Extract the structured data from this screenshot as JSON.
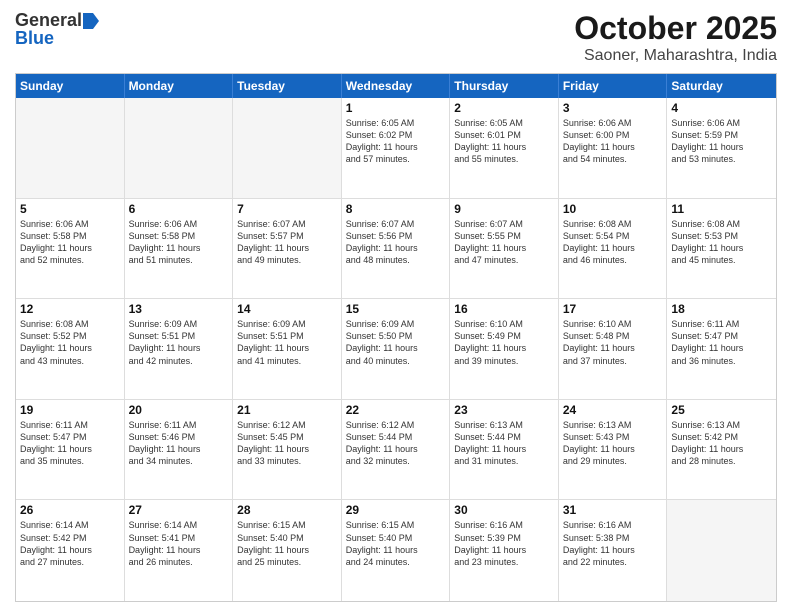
{
  "logo": {
    "general": "General",
    "blue": "Blue"
  },
  "title": "October 2025",
  "location": "Saoner, Maharashtra, India",
  "headers": [
    "Sunday",
    "Monday",
    "Tuesday",
    "Wednesday",
    "Thursday",
    "Friday",
    "Saturday"
  ],
  "rows": [
    [
      {
        "day": "",
        "info": "",
        "empty": true
      },
      {
        "day": "",
        "info": "",
        "empty": true
      },
      {
        "day": "",
        "info": "",
        "empty": true
      },
      {
        "day": "1",
        "info": "Sunrise: 6:05 AM\nSunset: 6:02 PM\nDaylight: 11 hours\nand 57 minutes."
      },
      {
        "day": "2",
        "info": "Sunrise: 6:05 AM\nSunset: 6:01 PM\nDaylight: 11 hours\nand 55 minutes."
      },
      {
        "day": "3",
        "info": "Sunrise: 6:06 AM\nSunset: 6:00 PM\nDaylight: 11 hours\nand 54 minutes."
      },
      {
        "day": "4",
        "info": "Sunrise: 6:06 AM\nSunset: 5:59 PM\nDaylight: 11 hours\nand 53 minutes."
      }
    ],
    [
      {
        "day": "5",
        "info": "Sunrise: 6:06 AM\nSunset: 5:58 PM\nDaylight: 11 hours\nand 52 minutes."
      },
      {
        "day": "6",
        "info": "Sunrise: 6:06 AM\nSunset: 5:58 PM\nDaylight: 11 hours\nand 51 minutes."
      },
      {
        "day": "7",
        "info": "Sunrise: 6:07 AM\nSunset: 5:57 PM\nDaylight: 11 hours\nand 49 minutes."
      },
      {
        "day": "8",
        "info": "Sunrise: 6:07 AM\nSunset: 5:56 PM\nDaylight: 11 hours\nand 48 minutes."
      },
      {
        "day": "9",
        "info": "Sunrise: 6:07 AM\nSunset: 5:55 PM\nDaylight: 11 hours\nand 47 minutes."
      },
      {
        "day": "10",
        "info": "Sunrise: 6:08 AM\nSunset: 5:54 PM\nDaylight: 11 hours\nand 46 minutes."
      },
      {
        "day": "11",
        "info": "Sunrise: 6:08 AM\nSunset: 5:53 PM\nDaylight: 11 hours\nand 45 minutes."
      }
    ],
    [
      {
        "day": "12",
        "info": "Sunrise: 6:08 AM\nSunset: 5:52 PM\nDaylight: 11 hours\nand 43 minutes."
      },
      {
        "day": "13",
        "info": "Sunrise: 6:09 AM\nSunset: 5:51 PM\nDaylight: 11 hours\nand 42 minutes."
      },
      {
        "day": "14",
        "info": "Sunrise: 6:09 AM\nSunset: 5:51 PM\nDaylight: 11 hours\nand 41 minutes."
      },
      {
        "day": "15",
        "info": "Sunrise: 6:09 AM\nSunset: 5:50 PM\nDaylight: 11 hours\nand 40 minutes."
      },
      {
        "day": "16",
        "info": "Sunrise: 6:10 AM\nSunset: 5:49 PM\nDaylight: 11 hours\nand 39 minutes."
      },
      {
        "day": "17",
        "info": "Sunrise: 6:10 AM\nSunset: 5:48 PM\nDaylight: 11 hours\nand 37 minutes."
      },
      {
        "day": "18",
        "info": "Sunrise: 6:11 AM\nSunset: 5:47 PM\nDaylight: 11 hours\nand 36 minutes."
      }
    ],
    [
      {
        "day": "19",
        "info": "Sunrise: 6:11 AM\nSunset: 5:47 PM\nDaylight: 11 hours\nand 35 minutes."
      },
      {
        "day": "20",
        "info": "Sunrise: 6:11 AM\nSunset: 5:46 PM\nDaylight: 11 hours\nand 34 minutes."
      },
      {
        "day": "21",
        "info": "Sunrise: 6:12 AM\nSunset: 5:45 PM\nDaylight: 11 hours\nand 33 minutes."
      },
      {
        "day": "22",
        "info": "Sunrise: 6:12 AM\nSunset: 5:44 PM\nDaylight: 11 hours\nand 32 minutes."
      },
      {
        "day": "23",
        "info": "Sunrise: 6:13 AM\nSunset: 5:44 PM\nDaylight: 11 hours\nand 31 minutes."
      },
      {
        "day": "24",
        "info": "Sunrise: 6:13 AM\nSunset: 5:43 PM\nDaylight: 11 hours\nand 29 minutes."
      },
      {
        "day": "25",
        "info": "Sunrise: 6:13 AM\nSunset: 5:42 PM\nDaylight: 11 hours\nand 28 minutes."
      }
    ],
    [
      {
        "day": "26",
        "info": "Sunrise: 6:14 AM\nSunset: 5:42 PM\nDaylight: 11 hours\nand 27 minutes."
      },
      {
        "day": "27",
        "info": "Sunrise: 6:14 AM\nSunset: 5:41 PM\nDaylight: 11 hours\nand 26 minutes."
      },
      {
        "day": "28",
        "info": "Sunrise: 6:15 AM\nSunset: 5:40 PM\nDaylight: 11 hours\nand 25 minutes."
      },
      {
        "day": "29",
        "info": "Sunrise: 6:15 AM\nSunset: 5:40 PM\nDaylight: 11 hours\nand 24 minutes."
      },
      {
        "day": "30",
        "info": "Sunrise: 6:16 AM\nSunset: 5:39 PM\nDaylight: 11 hours\nand 23 minutes."
      },
      {
        "day": "31",
        "info": "Sunrise: 6:16 AM\nSunset: 5:38 PM\nDaylight: 11 hours\nand 22 minutes."
      },
      {
        "day": "",
        "info": "",
        "empty": true
      }
    ]
  ]
}
